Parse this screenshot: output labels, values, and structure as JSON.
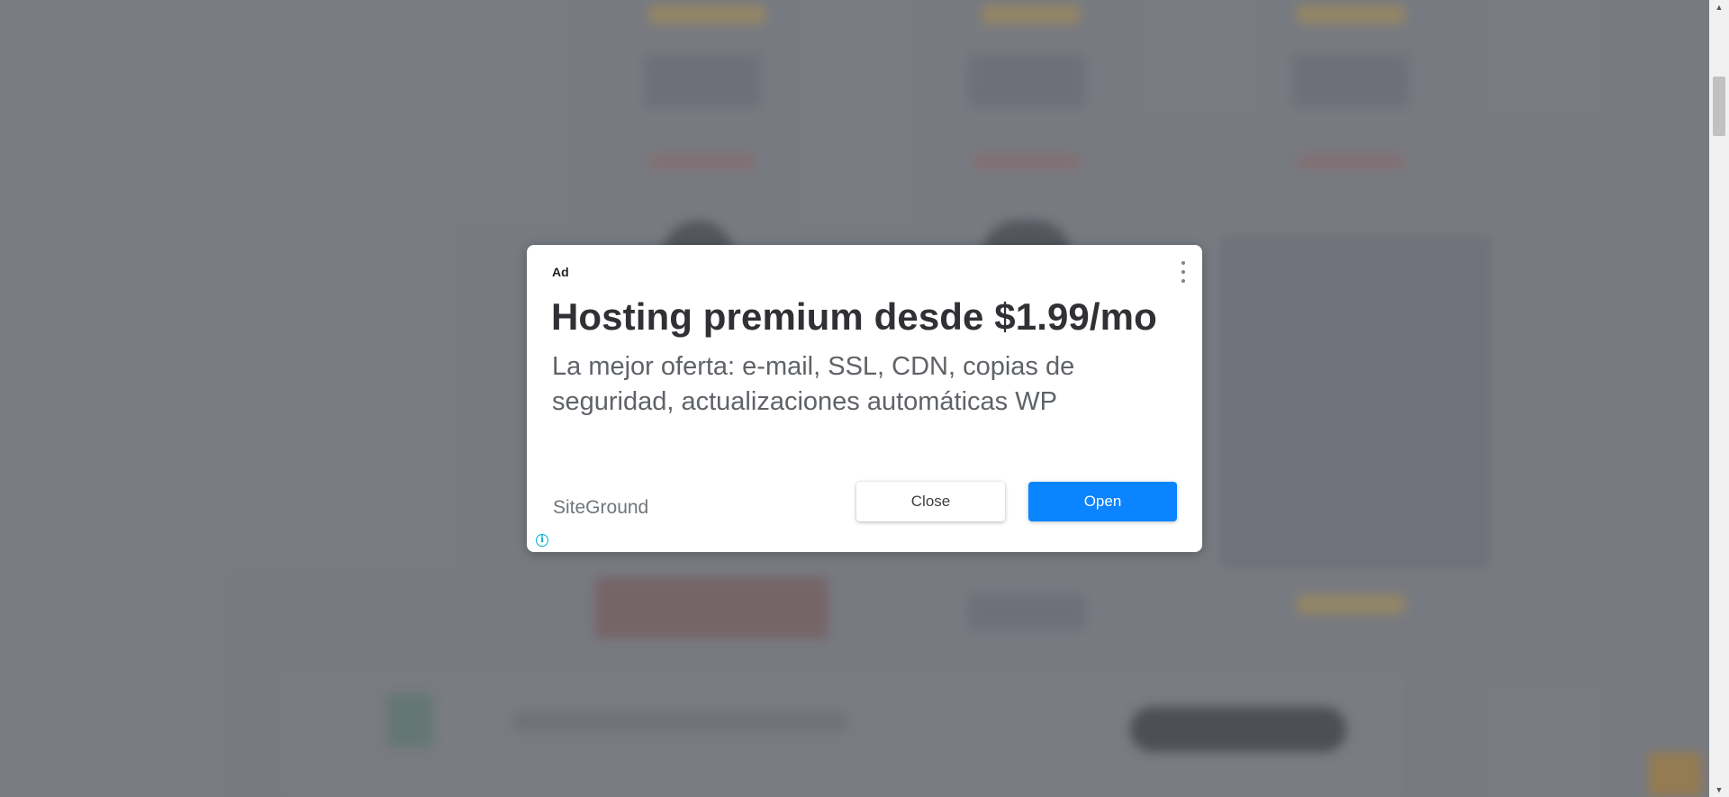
{
  "ad": {
    "label": "Ad",
    "title": "Hosting premium desde $1.99/mo",
    "description": "La mejor oferta: e-mail, SSL, CDN, copias de seguridad, actualizaciones automáticas WP",
    "advertiser": "SiteGround",
    "close_label": "Close",
    "open_label": "Open",
    "info_icon_glyph": "i",
    "accent_color": "#0a84ff"
  },
  "scrollbar": {
    "up_glyph": "▲",
    "down_glyph": "▼"
  }
}
